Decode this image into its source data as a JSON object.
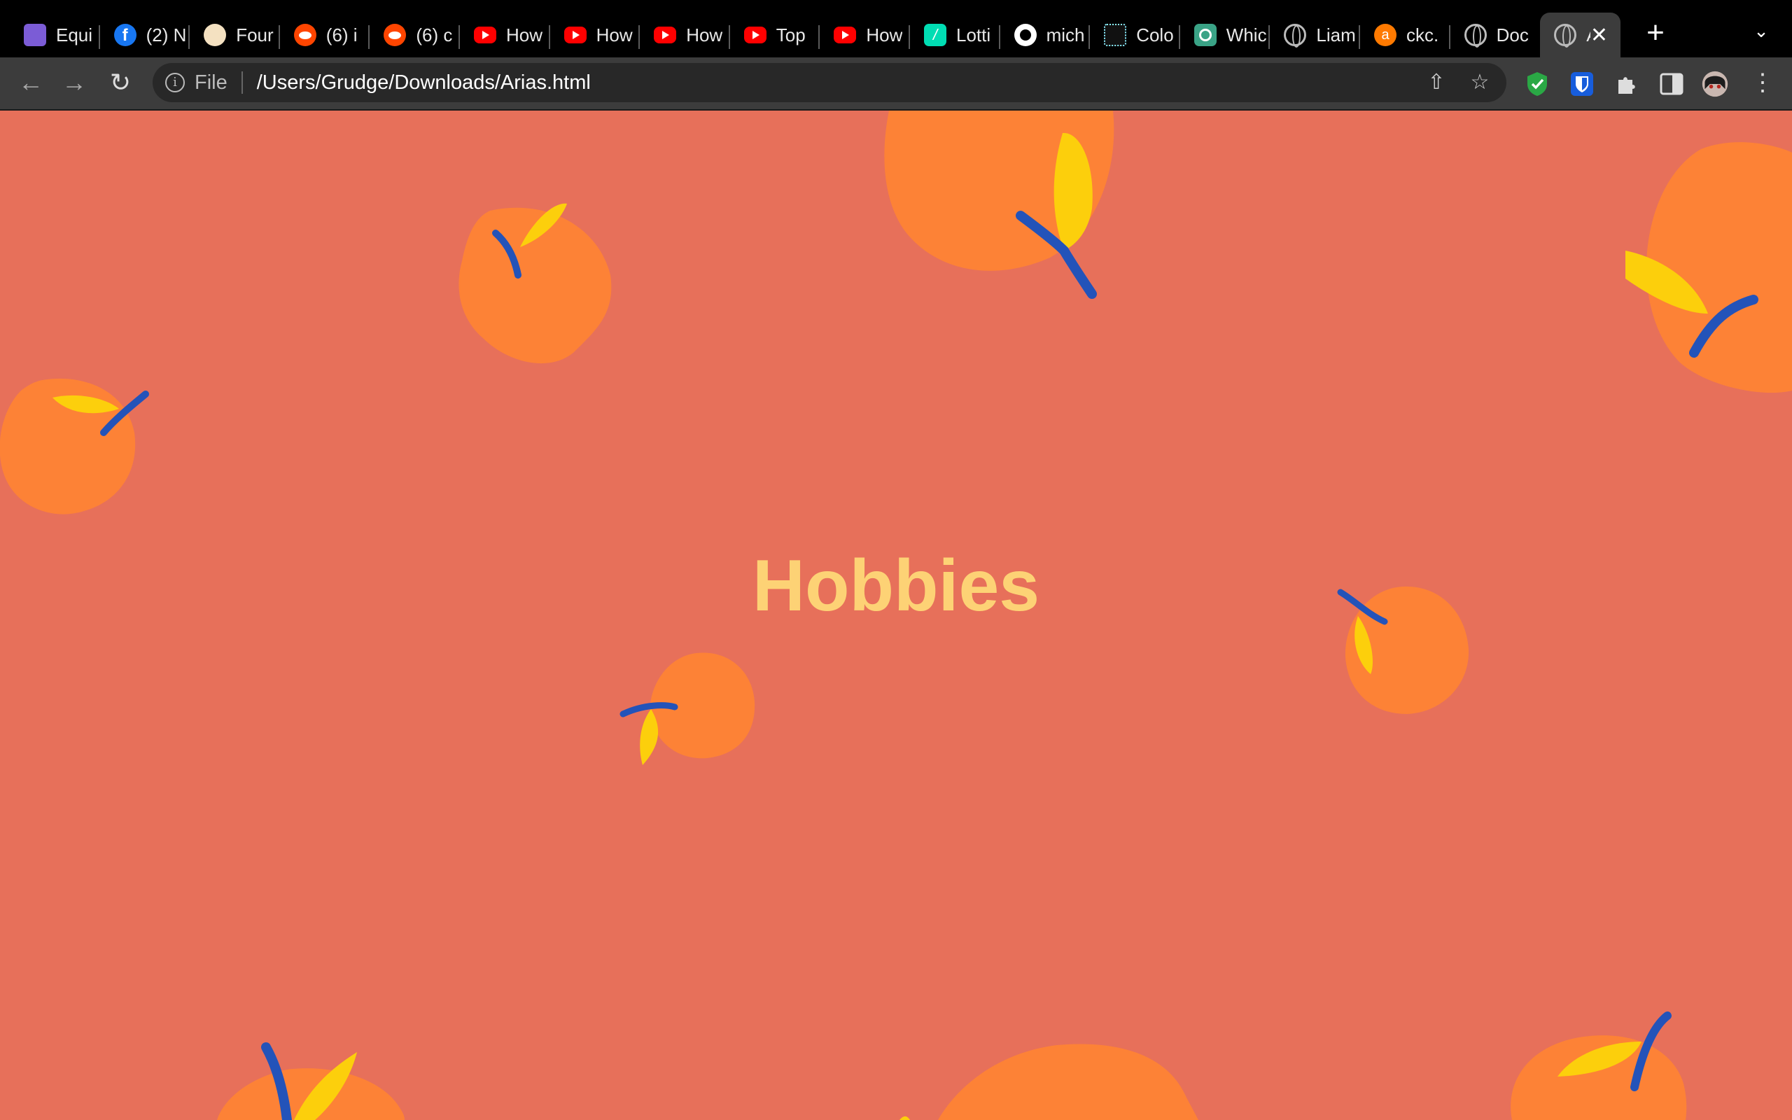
{
  "tabs": [
    {
      "label": "Equi",
      "icon": "equi-icon"
    },
    {
      "label": "(2) N",
      "icon": "facebook-icon"
    },
    {
      "label": "Four",
      "icon": "four-icon"
    },
    {
      "label": "(6) i",
      "icon": "reddit-icon"
    },
    {
      "label": "(6) c",
      "icon": "reddit-icon"
    },
    {
      "label": "How",
      "icon": "youtube-icon"
    },
    {
      "label": "How",
      "icon": "youtube-icon"
    },
    {
      "label": "How",
      "icon": "youtube-icon"
    },
    {
      "label": "Top",
      "icon": "youtube-icon"
    },
    {
      "label": "How",
      "icon": "youtube-icon"
    },
    {
      "label": "Lotti",
      "icon": "lottie-icon"
    },
    {
      "label": "mich",
      "icon": "github-icon"
    },
    {
      "label": "Colo",
      "icon": "color-icon"
    },
    {
      "label": "Whic",
      "icon": "openai-icon"
    },
    {
      "label": "Liam",
      "icon": "globe-icon"
    },
    {
      "label": "ckc.",
      "icon": "ckc-icon"
    },
    {
      "label": "Doc",
      "icon": "globe-icon"
    },
    {
      "label": "A",
      "icon": "globe-icon",
      "active": true
    }
  ],
  "toolbar": {
    "scheme_label": "File",
    "url": "/Users/Grudge/Downloads/Arias.html"
  },
  "page": {
    "heading": "Hobbies",
    "colors": {
      "background": "#e7705a",
      "heading": "#fdd275",
      "orange": "#fd8236",
      "leaf": "#fccf0c",
      "stem": "#2353b9"
    }
  }
}
